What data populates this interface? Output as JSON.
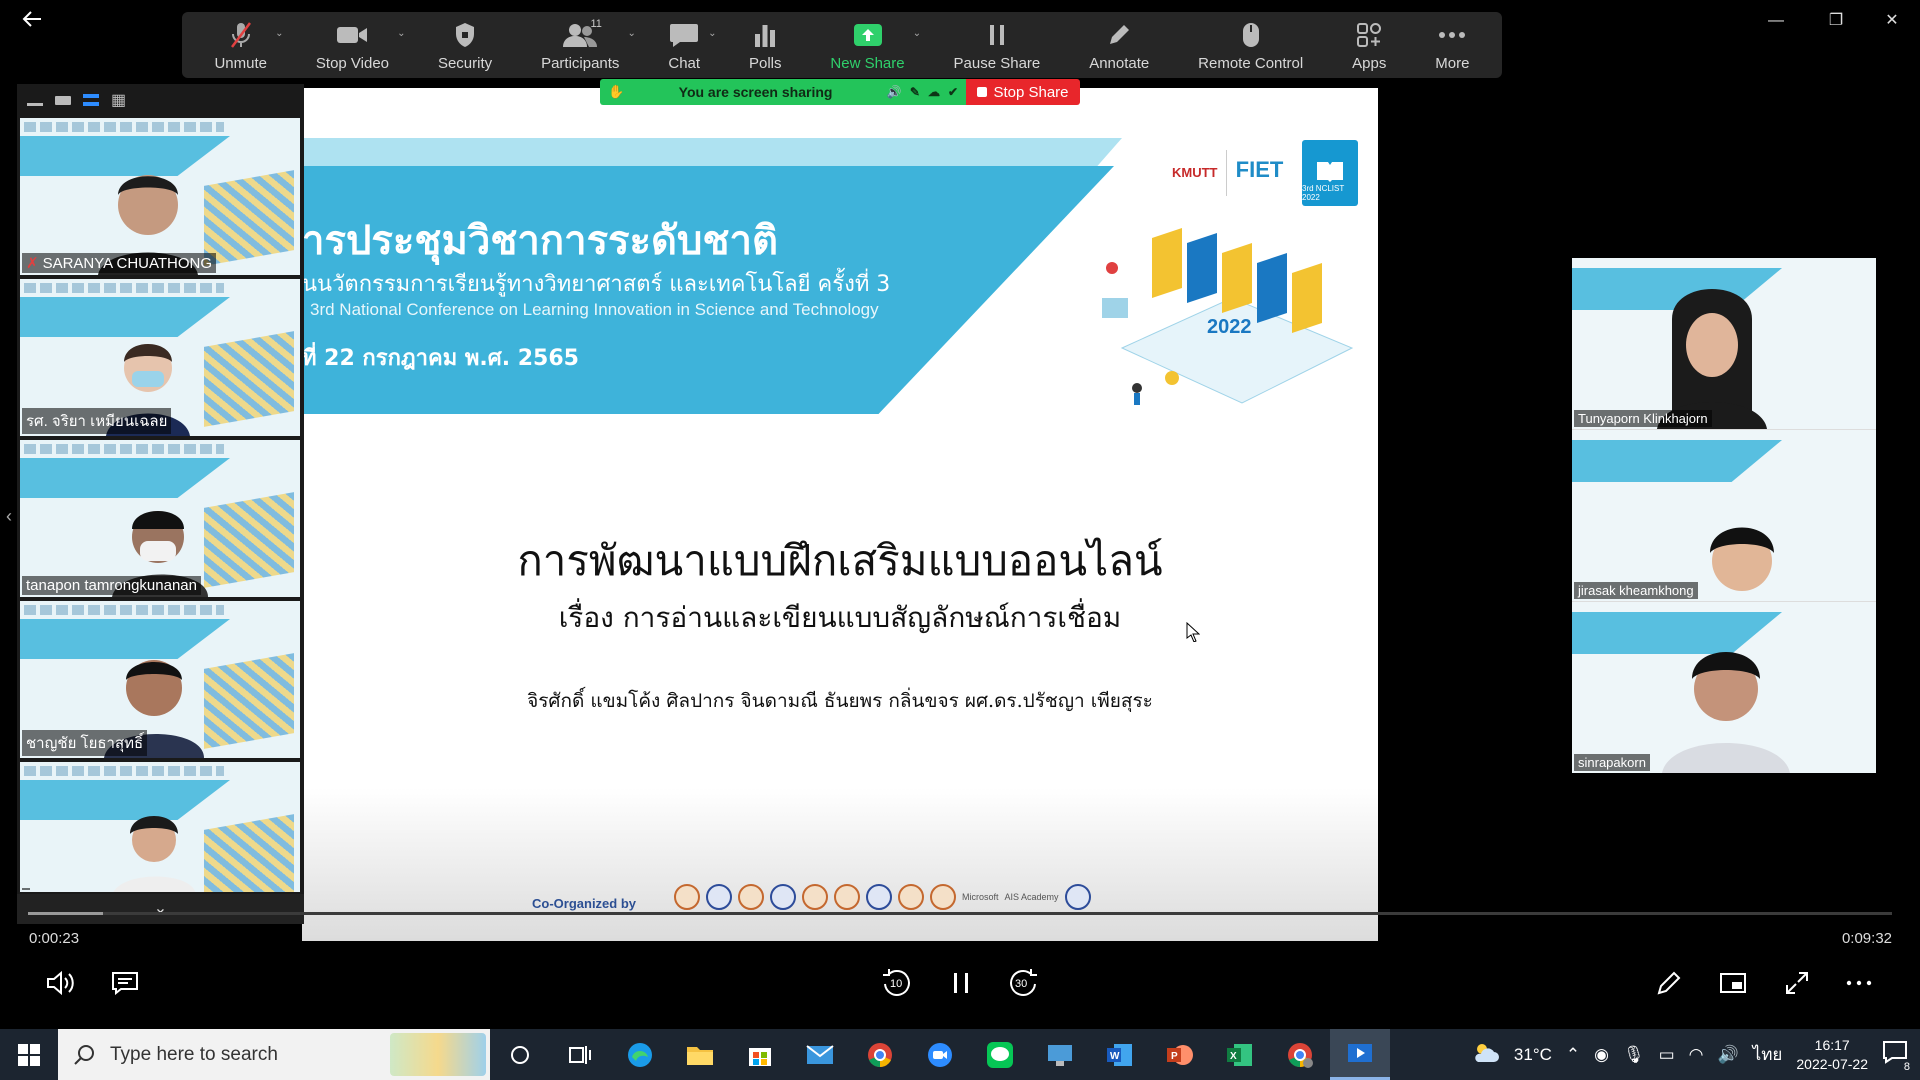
{
  "window": {
    "minimize": "—",
    "maximize": "❐",
    "close": "✕"
  },
  "toolbar": {
    "items": [
      {
        "label": "Unmute"
      },
      {
        "label": "Stop Video"
      },
      {
        "label": "Security"
      },
      {
        "label": "Participants",
        "badge": "11"
      },
      {
        "label": "Chat"
      },
      {
        "label": "Polls"
      },
      {
        "label": "New Share"
      },
      {
        "label": "Pause Share"
      },
      {
        "label": "Annotate"
      },
      {
        "label": "Remote Control"
      },
      {
        "label": "Apps"
      },
      {
        "label": "More"
      }
    ],
    "accent": "#2fd06b"
  },
  "share_banner": {
    "text": "You are screen sharing",
    "stop": "Stop Share",
    "bg": "#23c45a",
    "stop_bg": "#e8262b"
  },
  "slide": {
    "title": "ารประชุมวิชาการระดับชาติ",
    "subtitle_th": "นนวัตกรรมการเรียนรู้ทางวิทยาศาสตร์ และเทคโนโลยี ครั้งที่ 3",
    "subtitle_en": "3rd National Conference on Learning Innovation in Science and Technology",
    "date": "ที่ 22 กรกฎาคม พ.ศ. 2565",
    "logo_kmutt": "KMUTT",
    "logo_fiet": "FIET",
    "logo_nclist": "3rd NCLIST 2022",
    "heading": "การพัฒนาแบบฝึกเสริมแบบออนไลน์",
    "subheading": "เรื่อง การอ่านและเขียนแบบสัญลักษณ์การเชื่อม",
    "authors": "จิรศักดิ์ แขมโค้ง ศิลปากร จินดามณี ธันยพร กลิ่นขจร ผศ.ดร.ปรัชญา เพียสุระ",
    "coorg": "Co-Organized by",
    "sponsor_ms": "Microsoft",
    "sponsor_ais": "AIS Academy",
    "banner_color": "#3eb3da"
  },
  "gallery": {
    "participants": [
      {
        "name": "SARANYA CHUATHONG",
        "muted": true
      },
      {
        "name": "รศ. จริยา เหมียนเฉลย"
      },
      {
        "name": "tanapon tamrongkunanan"
      },
      {
        "name": "ชาญชัย โยธาสุทธิ์"
      },
      {
        "name": ""
      }
    ],
    "more": "⌄"
  },
  "right_panel": {
    "participants": [
      {
        "name": "Tunyaporn Klinkhajorn"
      },
      {
        "name": "jirasak kheamkhong"
      },
      {
        "name": "sinrapakorn"
      }
    ]
  },
  "player": {
    "current_time": "0:00:23",
    "total_time": "0:09:32",
    "progress": 0.04,
    "rewind_label": "10",
    "forward_label": "30"
  },
  "taskbar": {
    "search_placeholder": "Type here to search",
    "weather": "31°C",
    "lang": "ไทย",
    "time": "16:17",
    "date": "2022-07-22",
    "notifications": "8"
  }
}
